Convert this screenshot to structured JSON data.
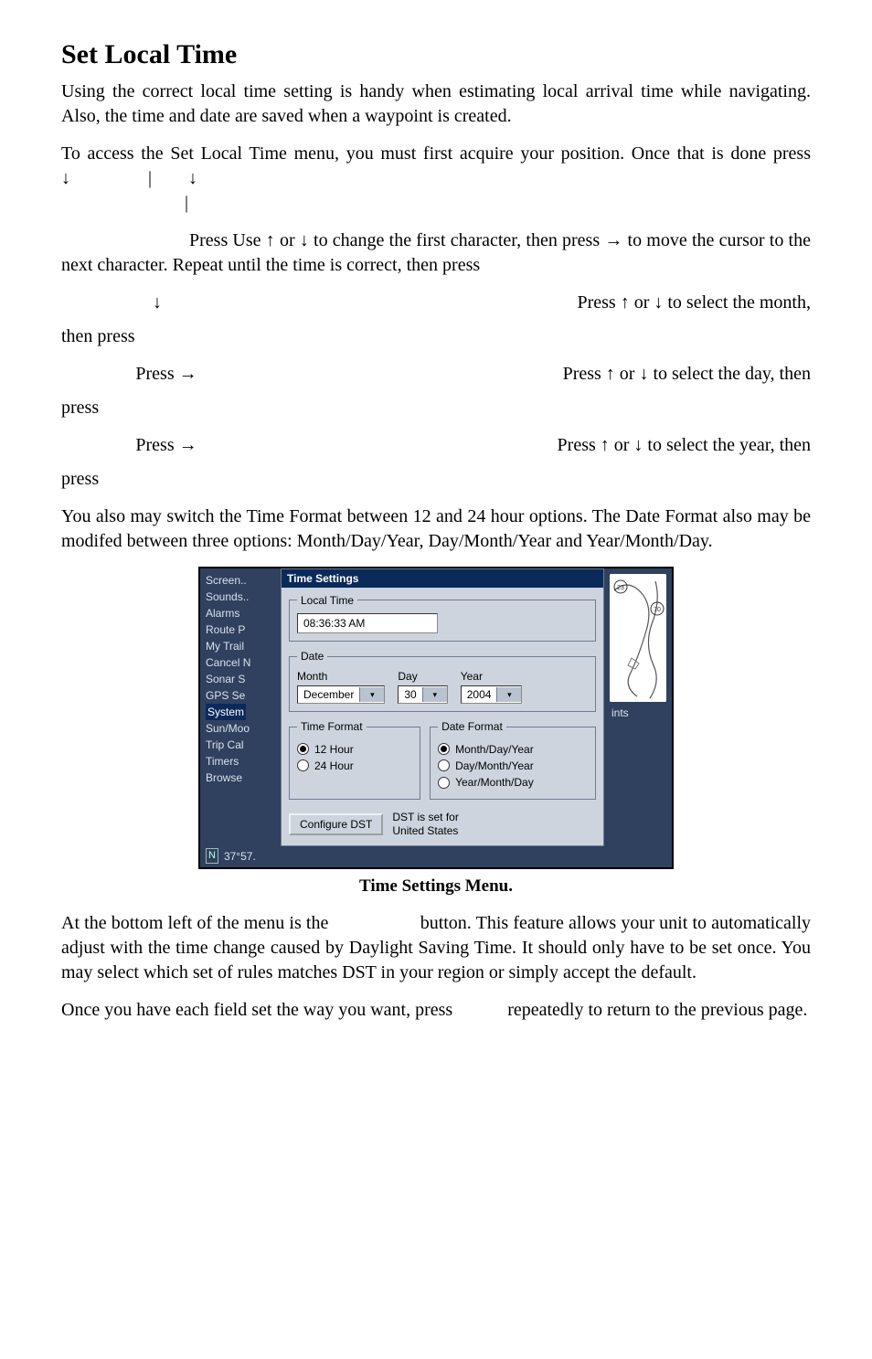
{
  "heading": "Set Local Time",
  "para1": "Using the correct local time setting is handy when estimating local arrival time while navigating. Also, the time and date are saved when a waypoint is created.",
  "para2_a": "To access the Set Local Time menu, you must first acquire your position. Once that is done press",
  "para2_arrows": "↓                 |        ↓",
  "para2_pipe": "|",
  "para3_a": "Press         Use ↑ or ↓ to change the first character, then press → to move the cursor to the next character. Repeat until the time is correct, then press",
  "line_month_left": "↓",
  "line_month_right": "Press ↑ or ↓ to select the month,",
  "then_press_1": "then press",
  "line_day_left": "Press →",
  "line_day_right": "Press ↑ or ↓ to select the day, then",
  "press_1": "press",
  "line_year_left": "Press →",
  "line_year_right": "Press ↑ or ↓ to select the year, then",
  "press_2": "press",
  "para4": "You also may switch the Time Format between 12 and 24 hour options. The Date Format also may be modifed between three options: Month/Day/Year, Day/Month/Year and Year/Month/Day.",
  "caption": "Time Settings Menu.",
  "para5_a": "At the bottom left of the menu is the",
  "para5_b": "button. This feature allows your unit to automatically adjust with the time change caused by Daylight Saving Time. It should only have to be set once. You may select which set of rules matches DST in your region or simply accept the default.",
  "para6_a": "Once you have each field set the way you want, press",
  "para6_b": "repeatedly to return to the previous page.",
  "shot": {
    "sidemenu": [
      "Screen..",
      "Sounds..",
      "Alarms",
      "Route P",
      "My Trail",
      "Cancel N",
      "Sonar S",
      "GPS Se",
      "System",
      "Sun/Moo",
      "Trip Cal",
      "Timers",
      "Browse"
    ],
    "sidemenu_selected": "System",
    "title": "Time Settings",
    "local_time_legend": "Local Time",
    "local_time_value": "08:36:33  AM",
    "date_legend": "Date",
    "month_label": "Month",
    "month_value": "December",
    "day_label": "Day",
    "day_value": "30",
    "year_label": "Year",
    "year_value": "2004",
    "tf_legend": "Time Format",
    "tf_12": "12 Hour",
    "tf_24": "24 Hour",
    "df_legend": "Date Format",
    "df_mdy": "Month/Day/Year",
    "df_dmy": "Day/Month/Year",
    "df_ymd": "Year/Month/Day",
    "dst_btn": "Configure DST",
    "dst_note1": "DST is set for",
    "dst_note2": "United States",
    "right_label": "ints",
    "coord": "37°57.",
    "hwy23": "23",
    "hwy70": "70"
  }
}
